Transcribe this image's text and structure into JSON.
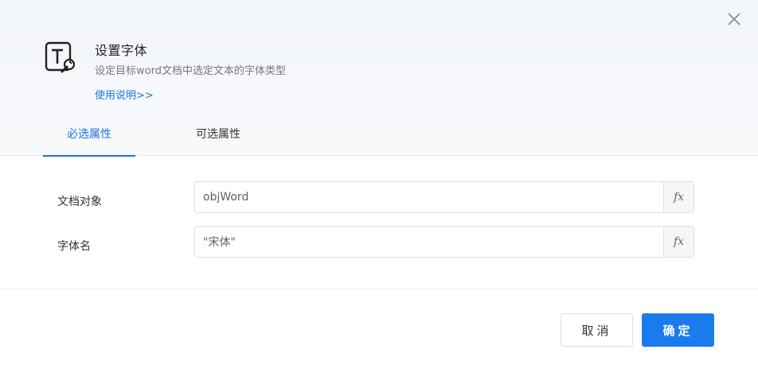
{
  "dialog": {
    "title": "设置字体",
    "subtitle": "设定目标word文档中选定文本的字体类型",
    "help_link": "使用说明>>",
    "icon": "text-format-wrench-icon"
  },
  "tabs": [
    {
      "label": "必选属性",
      "active": true
    },
    {
      "label": "可选属性",
      "active": false
    }
  ],
  "fields": [
    {
      "label": "文档对象",
      "value": "objWord",
      "fx": "fx"
    },
    {
      "label": "字体名",
      "value": "\"宋体\"",
      "fx": "fx"
    }
  ],
  "buttons": {
    "cancel": "取消",
    "ok": "确定"
  },
  "colors": {
    "accent": "#1a73e8",
    "primary_button": "#1a7bef"
  }
}
